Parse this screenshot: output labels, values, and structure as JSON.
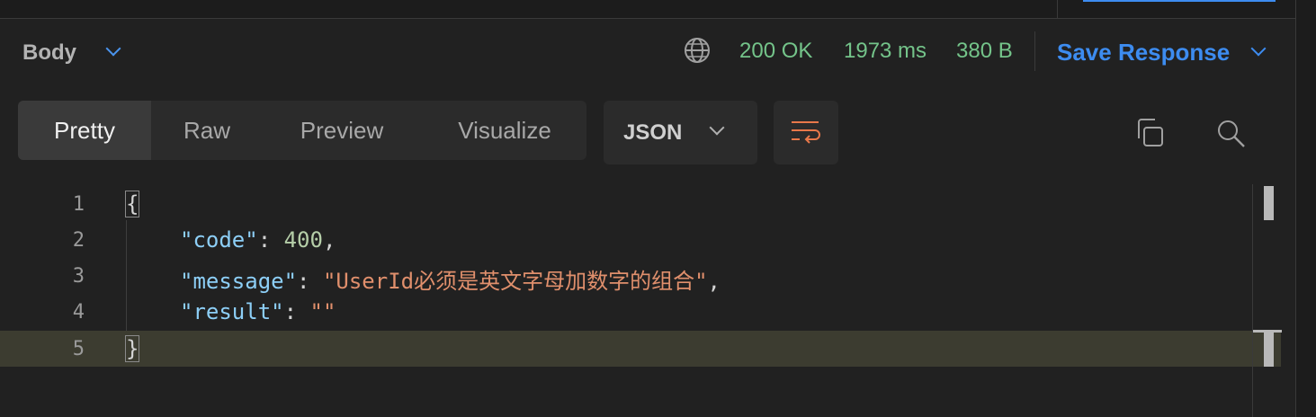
{
  "header": {
    "body_label": "Body",
    "status_code": "200 OK",
    "time": "1973 ms",
    "size": "380 B",
    "save_response": "Save Response"
  },
  "view_tabs": [
    "Pretty",
    "Raw",
    "Preview",
    "Visualize"
  ],
  "active_tab": "Pretty",
  "format": "JSON",
  "icons": {
    "body_dropdown": "chevron-down-icon",
    "network": "globe-icon",
    "save_dropdown": "chevron-down-icon",
    "format_dropdown": "chevron-down-icon",
    "wrap": "wrap-lines-icon",
    "copy": "copy-icon",
    "search": "search-icon"
  },
  "editor": {
    "line_numbers": [
      "1",
      "2",
      "3",
      "4",
      "5"
    ],
    "open_brace": "{",
    "close_brace": "}",
    "k1": "\"code\"",
    "v1": "400",
    "k2": "\"message\"",
    "v2": "\"UserId必须是英文字母加数字的组合\"",
    "k3": "\"result\"",
    "v3": "\"\""
  },
  "colors": {
    "accent": "#3d8cf0",
    "status_ok": "#74c48a",
    "json_key": "#8dcff7",
    "json_number": "#b5cea8",
    "json_string": "#e08f6c",
    "wrap_icon": "#e8784a"
  }
}
